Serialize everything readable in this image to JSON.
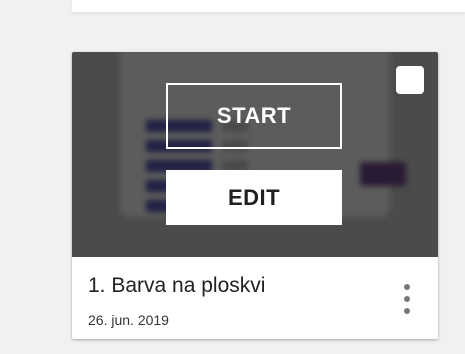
{
  "card": {
    "start_label": "START",
    "edit_label": "EDIT",
    "title": "1. Barva na ploskvi",
    "date": "26. jun. 2019",
    "menu_icon": "more-vert-icon",
    "checkbox_checked": false
  },
  "colors": {
    "thumbnail_bg": "#4b4b4b",
    "page_bg": "#f1f1f1"
  }
}
